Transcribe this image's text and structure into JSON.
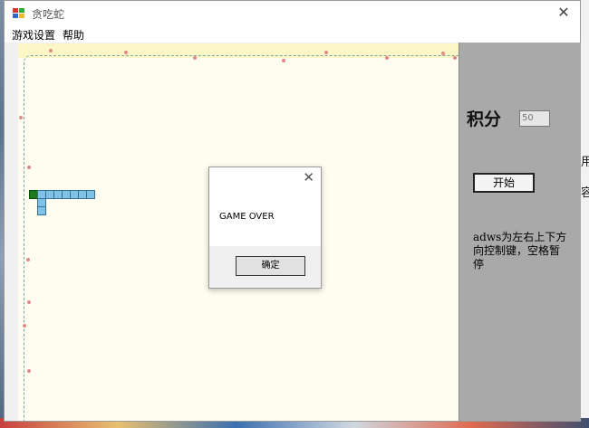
{
  "window": {
    "title": "贪吃蛇"
  },
  "menu": {
    "items": [
      "游戏设置",
      "帮助"
    ]
  },
  "panel": {
    "score_label": "积分",
    "score_value": "50",
    "start_button": "开始",
    "help_text": "adws为左右上下方向控制键，空格暂停"
  },
  "dialog": {
    "message": "GAME OVER",
    "ok_button": "确定"
  },
  "background_text": {
    "line1": "用",
    "line2": "容"
  },
  "colors": {
    "panel": "#a9a9a9",
    "field": "#fffdf0",
    "snake_head": "#1c7a1c",
    "snake_body": "#7ec3e6"
  }
}
